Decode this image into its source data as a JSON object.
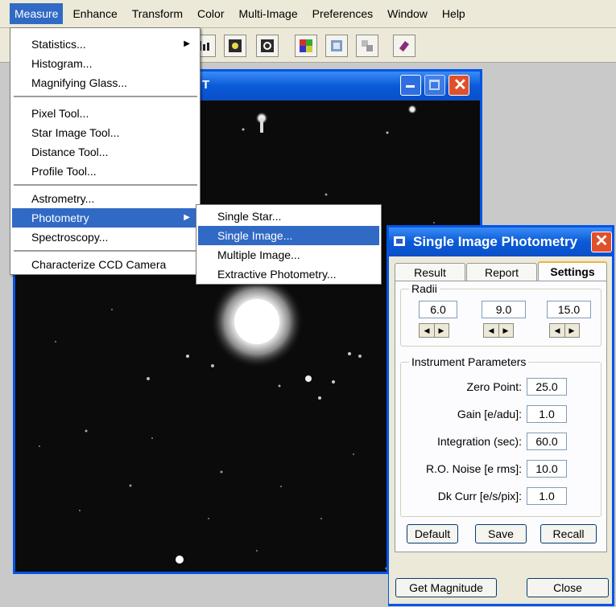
{
  "menubar": {
    "items": [
      "Measure",
      "Enhance",
      "Transform",
      "Color",
      "Multi-Image",
      "Preferences",
      "Window",
      "Help"
    ],
    "active_index": 0
  },
  "toolbar": {
    "icons": [
      "histogram-icon",
      "image-tool-icon",
      "image-tool-2-icon",
      "color-grid-icon",
      "stack-icon",
      "align-icon",
      "book-icon"
    ]
  },
  "image_window": {
    "title_fragment": "T"
  },
  "measure_menu": {
    "items": [
      {
        "label": "Statistics...",
        "submenu": true
      },
      {
        "label": "Histogram..."
      },
      {
        "label": "Magnifying Glass..."
      },
      {
        "label": "Pixel Tool..."
      },
      {
        "label": "Star Image Tool..."
      },
      {
        "label": "Distance Tool..."
      },
      {
        "label": "Profile Tool..."
      },
      {
        "label": "Astrometry..."
      },
      {
        "label": "Photometry",
        "submenu": true,
        "active": true
      },
      {
        "label": "Spectroscopy..."
      },
      {
        "label": "Characterize CCD Camera"
      }
    ]
  },
  "photometry_submenu": {
    "items": [
      "Single Star...",
      "Single Image...",
      "Multiple Image...",
      "Extractive Photometry..."
    ],
    "active_index": 1
  },
  "dialog": {
    "title": "Single Image Photometry",
    "tabs": [
      "Result",
      "Report",
      "Settings"
    ],
    "selected_tab": "Settings",
    "radii": {
      "legend": "Radii",
      "values": [
        "6.0",
        "9.0",
        "15.0"
      ]
    },
    "instrument": {
      "legend": "Instrument Parameters",
      "params": [
        {
          "label": "Zero Point:",
          "value": "25.0"
        },
        {
          "label": "Gain [e/adu]:",
          "value": "1.0"
        },
        {
          "label": "Integration (sec):",
          "value": "60.0"
        },
        {
          "label": "R.O. Noise [e rms]:",
          "value": "10.0"
        },
        {
          "label": "Dk Curr [e/s/pix]:",
          "value": "1.0"
        }
      ]
    },
    "buttons": {
      "default": "Default",
      "save": "Save",
      "recall": "Recall",
      "get_magnitude": "Get Magnitude",
      "close": "Close"
    }
  },
  "colors": {
    "xp_blue": "#0055e5",
    "highlight": "#316ac5",
    "close_red": "#e0502a",
    "tab_accent": "#f0b33c"
  }
}
